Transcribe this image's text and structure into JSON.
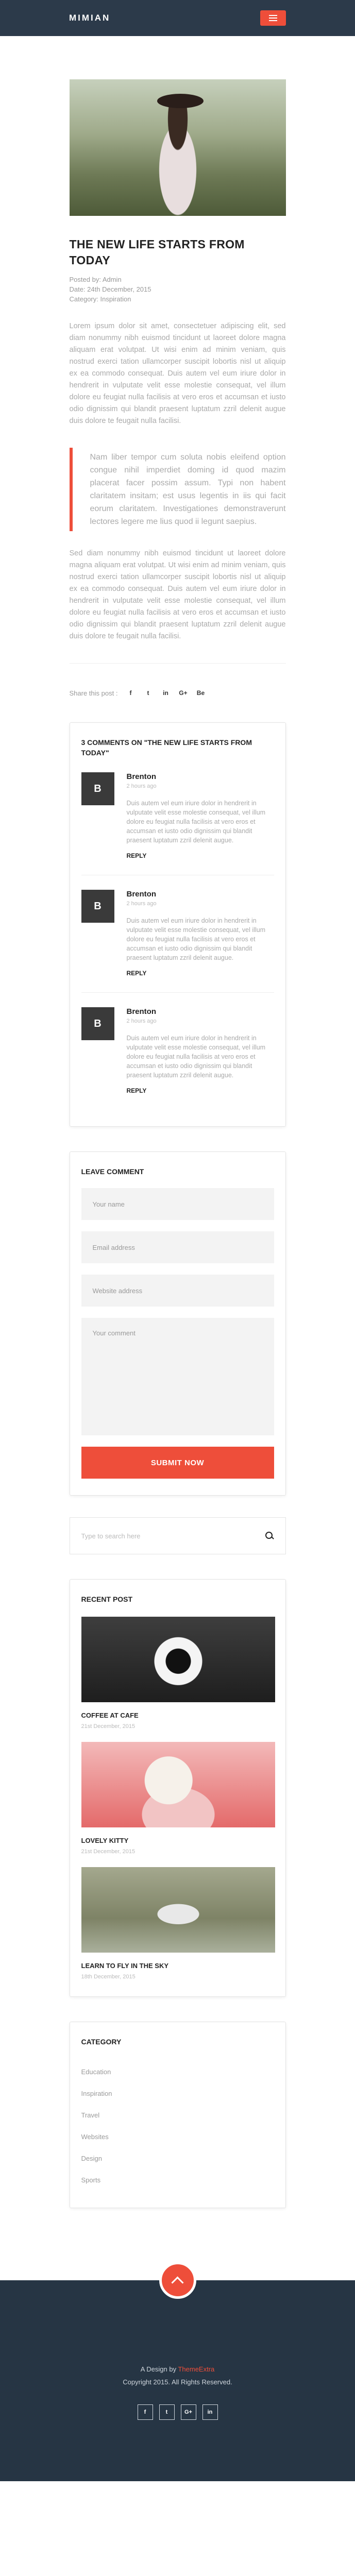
{
  "header": {
    "logo": "MIMIAN",
    "menu_icon": "hamburger-icon"
  },
  "post": {
    "title": "THE NEW LIFE STARTS FROM TODAY",
    "meta": [
      "Posted by: Admin",
      "Date: 24th December, 2015",
      "Category: Inspiration"
    ],
    "para1": "Lorem ipsum dolor sit amet, consectetuer adipiscing elit, sed diam nonummy nibh euismod tincidunt ut laoreet dolore magna aliquam erat volutpat. Ut wisi enim ad minim veniam, quis nostrud exerci tation ullamcorper suscipit lobortis nisl ut aliquip ex ea commodo consequat. Duis autem vel eum iriure dolor in hendrerit in vulputate velit esse molestie consequat, vel illum dolore eu feugiat nulla facilisis at vero eros et accumsan et iusto odio dignissim qui blandit praesent luptatum zzril delenit augue duis dolore te feugait nulla facilisi.",
    "quote": "Nam liber tempor cum soluta nobis eleifend option congue nihil imperdiet doming id quod mazim placerat facer possim assum. Typi non habent claritatem insitam; est usus legentis in iis qui facit eorum claritatem. Investigationes demonstraverunt lectores legere me lius quod ii legunt saepius.",
    "para2": "Sed diam nonummy nibh euismod tincidunt ut laoreet dolore magna aliquam erat volutpat. Ut wisi enim ad minim veniam, quis nostrud exerci tation ullamcorper suscipit lobortis nisl ut aliquip ex ea commodo consequat. Duis autem vel eum iriure dolor in hendrerit in vulputate velit esse molestie consequat, vel illum dolore eu feugiat nulla facilisis at vero eros et accumsan et iusto odio dignissim qui blandit praesent luptatum zzril delenit augue duis dolore te feugait nulla facilisi."
  },
  "share": {
    "label": "Share this post :",
    "icons": [
      "f",
      "t",
      "in",
      "G+",
      "Be"
    ]
  },
  "comments": {
    "title": "3 COMMENTS ON \"THE NEW LIFE STARTS FROM TODAY\"",
    "items": [
      {
        "initial": "B",
        "name": "Brenton",
        "time": "2 hours ago",
        "text": "Duis autem vel eum iriure dolor in hendrerit in vulputate velit esse molestie consequat, vel illum dolore eu feugiat nulla facilisis at vero eros et accumsan et iusto odio dignissim qui blandit praesent luptatum zzril delenit augue.",
        "reply": "REPLY"
      },
      {
        "initial": "B",
        "name": "Brenton",
        "time": "2 hours ago",
        "text": "Duis autem vel eum iriure dolor in hendrerit in vulputate velit esse molestie consequat, vel illum dolore eu feugiat nulla facilisis at vero eros et accumsan et iusto odio dignissim qui blandit praesent luptatum zzril delenit augue.",
        "reply": "REPLY"
      },
      {
        "initial": "B",
        "name": "Brenton",
        "time": "2 hours ago",
        "text": "Duis autem vel eum iriure dolor in hendrerit in vulputate velit esse molestie consequat, vel illum dolore eu feugiat nulla facilisis at vero eros et accumsan et iusto odio dignissim qui blandit praesent luptatum zzril delenit augue.",
        "reply": "REPLY"
      }
    ]
  },
  "leave_comment": {
    "title": "LEAVE COMMENT",
    "name_ph": "Your name",
    "email_ph": "Email address",
    "website_ph": "Website address",
    "comment_ph": "Your comment",
    "submit": "SUBMIT NOW"
  },
  "search": {
    "placeholder": "Type to search here",
    "icon": "search-icon"
  },
  "recent": {
    "title": "RECENT POST",
    "items": [
      {
        "img": "coffee",
        "title": "COFFEE AT CAFE",
        "date": "21st December, 2015"
      },
      {
        "img": "kitty",
        "title": "LOVELY KITTY",
        "date": "21st December, 2015"
      },
      {
        "img": "drone",
        "title": "LEARN TO FLY IN THE SKY",
        "date": "18th December, 2015"
      }
    ]
  },
  "category": {
    "title": "CATEGORY",
    "items": [
      "Education",
      "Inspiration",
      "Travel",
      "Websites",
      "Design",
      "Sports"
    ]
  },
  "footer": {
    "credit_prefix": "A Design by",
    "credit_brand": "ThemeExtra",
    "copyright": "Copyright 2015. All Rights Reserved.",
    "social": [
      "f",
      "t",
      "G+",
      "in"
    ],
    "accent": "#ee4e3a"
  }
}
